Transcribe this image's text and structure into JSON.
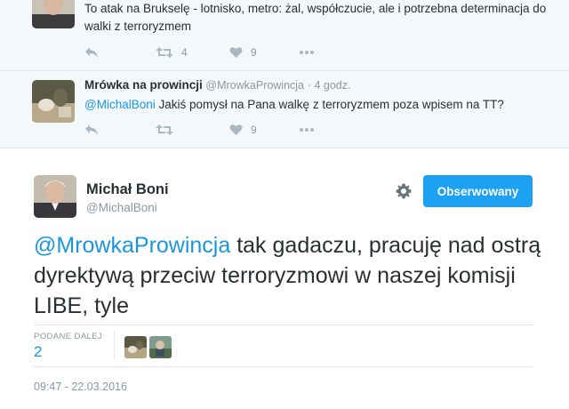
{
  "thread": {
    "tweets": [
      {
        "text": "To atak na Brukselę - lotnisko, metro: żal, współczucie, ale i potrzebna determinacja do walki z terroryzmem",
        "retweets": "4",
        "likes": "9"
      },
      {
        "fullname": "Mrówka na prowincji",
        "username": "@MrowkaProwincja",
        "separator": "·",
        "time": "4 godz.",
        "mention": "@MichalBoni",
        "text": " Jakiś pomysł na Pana walkę z terroryzmem poza wpisem na TT?",
        "likes": "9"
      }
    ]
  },
  "main": {
    "fullname": "Michał Boni",
    "username": "@MichalBoni",
    "follow_label": "Obserwowany",
    "mention": "@MrowkaProwincja",
    "text": " tak gadaczu, pracuję nad ostrą dyrektywą przeciw terroryzmowi w naszej komisji LIBE, tyle",
    "stats": {
      "retweets_label": "PODANE DALEJ",
      "retweets_value": "2"
    },
    "timestamp": "09:47 - 22.03.2016"
  },
  "icons": {
    "reply": "reply-icon",
    "retweet": "retweet-icon",
    "like": "heart-icon",
    "more": "more-icon",
    "settings": "gear-icon"
  },
  "colors": {
    "accent": "#1da1f2",
    "link": "#1b95e0",
    "muted": "#8899a6",
    "icon": "#aab8c2"
  }
}
